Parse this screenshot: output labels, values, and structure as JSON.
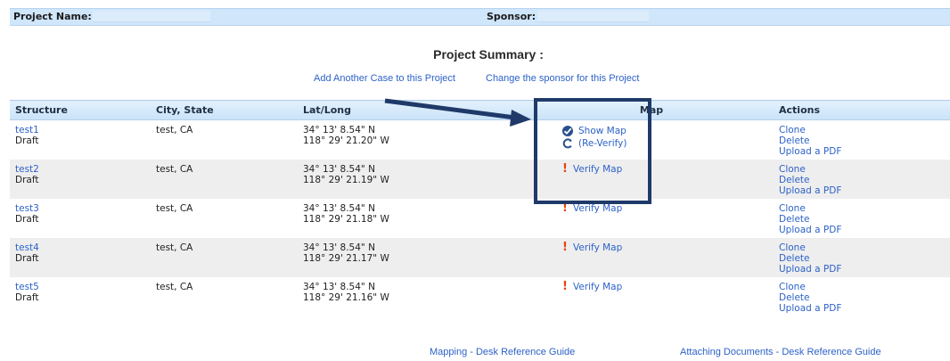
{
  "header": {
    "project_name_label": "Project Name:",
    "sponsor_label": "Sponsor:"
  },
  "summary": {
    "title": "Project Summary :",
    "add_case_link": "Add Another Case to this Project",
    "change_sponsor_link": "Change the sponsor for this Project"
  },
  "table": {
    "columns": [
      "Structure",
      "City, State",
      "Lat/Long",
      "Map",
      "Actions"
    ],
    "rows": [
      {
        "name": "test1",
        "status": "Draft",
        "city": "test, CA",
        "lat": "34° 13' 8.54\" N",
        "long": "118° 29' 21.20\" W",
        "map_primary": "Show Map",
        "map_secondary": "(Re-Verify)"
      },
      {
        "name": "test2",
        "status": "Draft",
        "city": "test, CA",
        "lat": "34° 13' 8.54\" N",
        "long": "118° 29' 21.19\" W",
        "map_primary": "Verify Map"
      },
      {
        "name": "test3",
        "status": "Draft",
        "city": "test, CA",
        "lat": "34° 13' 8.54\" N",
        "long": "118° 29' 21.18\" W",
        "map_primary": "Verify Map"
      },
      {
        "name": "test4",
        "status": "Draft",
        "city": "test, CA",
        "lat": "34° 13' 8.54\" N",
        "long": "118° 29' 21.17\" W",
        "map_primary": "Verify Map"
      },
      {
        "name": "test5",
        "status": "Draft",
        "city": "test, CA",
        "lat": "34° 13' 8.54\" N",
        "long": "118° 29' 21.16\" W",
        "map_primary": "Verify Map"
      }
    ],
    "actions": {
      "clone": "Clone",
      "delete": "Delete",
      "upload": "Upload a PDF"
    }
  },
  "footer": {
    "mapping_guide": "Mapping - Desk Reference Guide",
    "attaching_guide": "Attaching Documents - Desk Reference Guide"
  },
  "icons": {
    "verified": "check-badge-icon",
    "reverify": "refresh-icon",
    "unverified": "exclamation-icon"
  },
  "colors": {
    "link": "#2d62c8",
    "header_bg": "#cfe6fb",
    "highlight": "#1f3a69",
    "warning": "#e8420e"
  }
}
